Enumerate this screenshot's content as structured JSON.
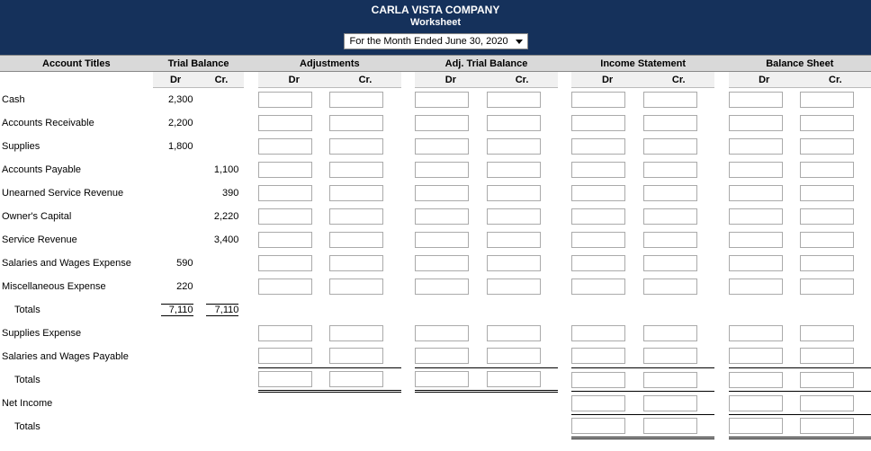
{
  "header": {
    "company": "CARLA VISTA COMPANY",
    "title": "Worksheet"
  },
  "period": "For the Month Ended June 30, 2020",
  "columns": {
    "account": "Account Titles",
    "trial": "Trial Balance",
    "adjust": "Adjustments",
    "adjtrial": "Adj. Trial Balance",
    "income": "Income Statement",
    "balance": "Balance Sheet",
    "dr": "Dr",
    "cr": "Cr."
  },
  "rows": [
    {
      "acct": "Cash",
      "tb_dr": "2,300",
      "tb_cr": ""
    },
    {
      "acct": "Accounts Receivable",
      "tb_dr": "2,200",
      "tb_cr": ""
    },
    {
      "acct": "Supplies",
      "tb_dr": "1,800",
      "tb_cr": ""
    },
    {
      "acct": "Accounts Payable",
      "tb_dr": "",
      "tb_cr": "1,100"
    },
    {
      "acct": "Unearned Service Revenue",
      "tb_dr": "",
      "tb_cr": "390"
    },
    {
      "acct": "Owner's Capital",
      "tb_dr": "",
      "tb_cr": "2,220"
    },
    {
      "acct": "Service Revenue",
      "tb_dr": "",
      "tb_cr": "3,400"
    },
    {
      "acct": "Salaries and Wages Expense",
      "tb_dr": "590",
      "tb_cr": ""
    },
    {
      "acct": "Miscellaneous Expense",
      "tb_dr": "220",
      "tb_cr": ""
    }
  ],
  "totals_label": "Totals",
  "tb_total_dr": "7,110",
  "tb_total_cr": "7,110",
  "extra_rows": [
    {
      "acct": "Supplies Expense"
    },
    {
      "acct": "Salaries and Wages Payable"
    }
  ],
  "net_income_label": "Net Income"
}
